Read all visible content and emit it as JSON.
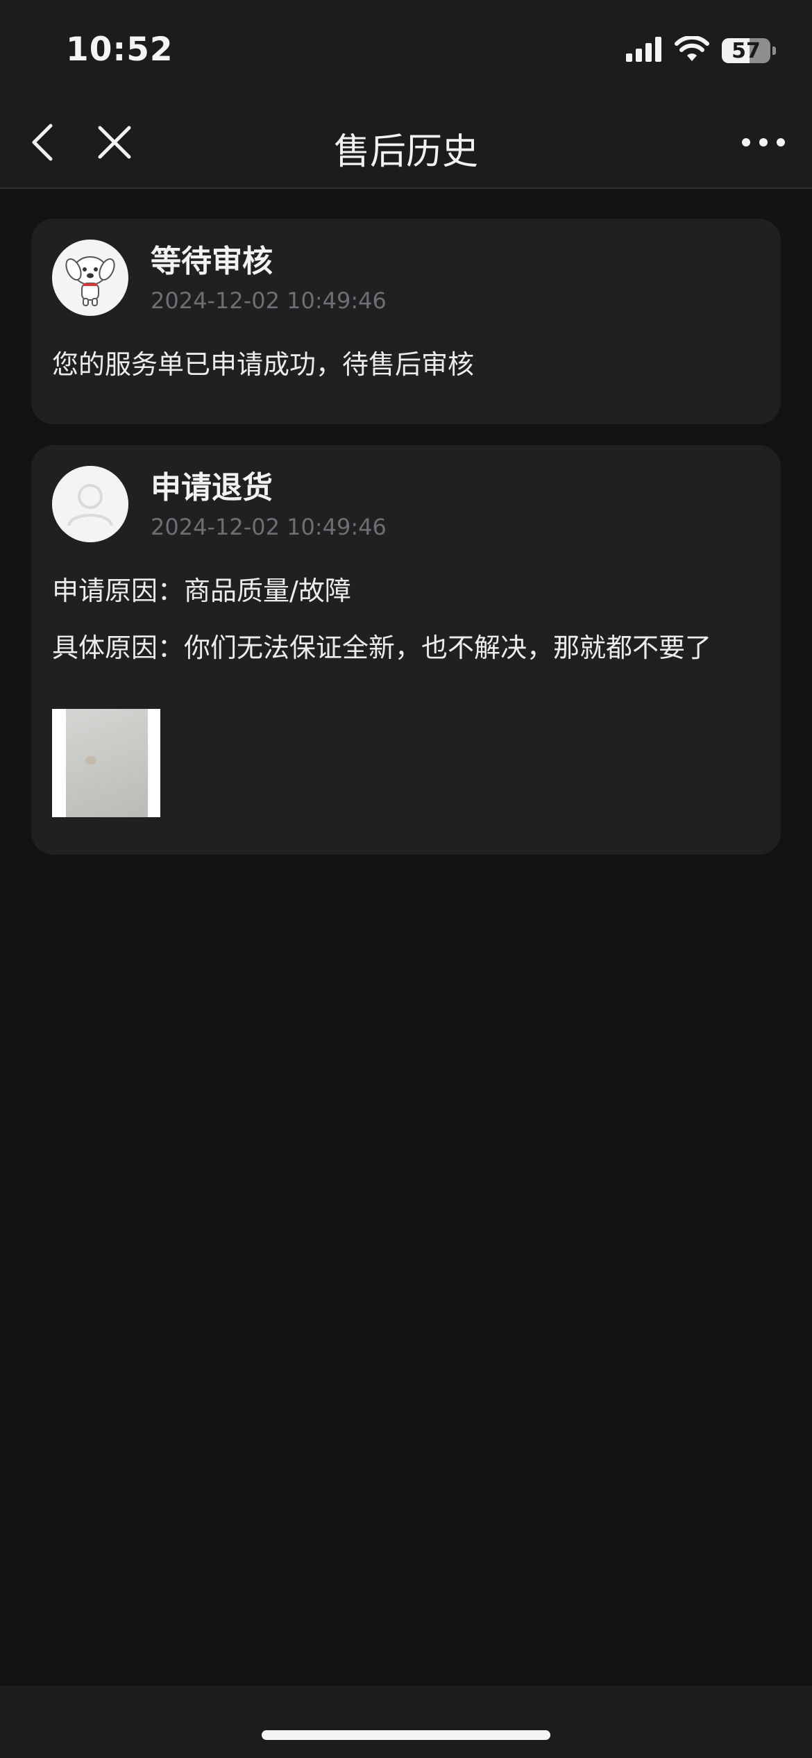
{
  "status_bar": {
    "time": "10:52",
    "battery_level": "57",
    "icons": [
      "cellular-signal-icon",
      "wifi-icon",
      "battery-icon"
    ]
  },
  "nav": {
    "title": "售后历史",
    "icons": [
      "back-chevron-icon",
      "close-icon",
      "more-dots-icon"
    ]
  },
  "history": [
    {
      "title": "等待审核",
      "time": "2024-12-02 10:49:46",
      "message": "您的服务单已申请成功，待售后审核",
      "avatar": "jd-dog-mascot-icon"
    },
    {
      "title": "申请退货",
      "time": "2024-12-02 10:49:46",
      "reason_label": "申请原因：",
      "reason_value": "商品质量/故障",
      "detail_label": "具体原因：",
      "detail_value": "你们无法保证全新，也不解决，那就都不要了",
      "avatar": "user-placeholder-icon",
      "attachments": [
        "photo-thumbnail"
      ]
    }
  ],
  "colors": {
    "background": "#141314",
    "card": "#201f21",
    "bar": "#1c1b1d",
    "text": "#ecebed",
    "muted": "#6f6e72"
  }
}
